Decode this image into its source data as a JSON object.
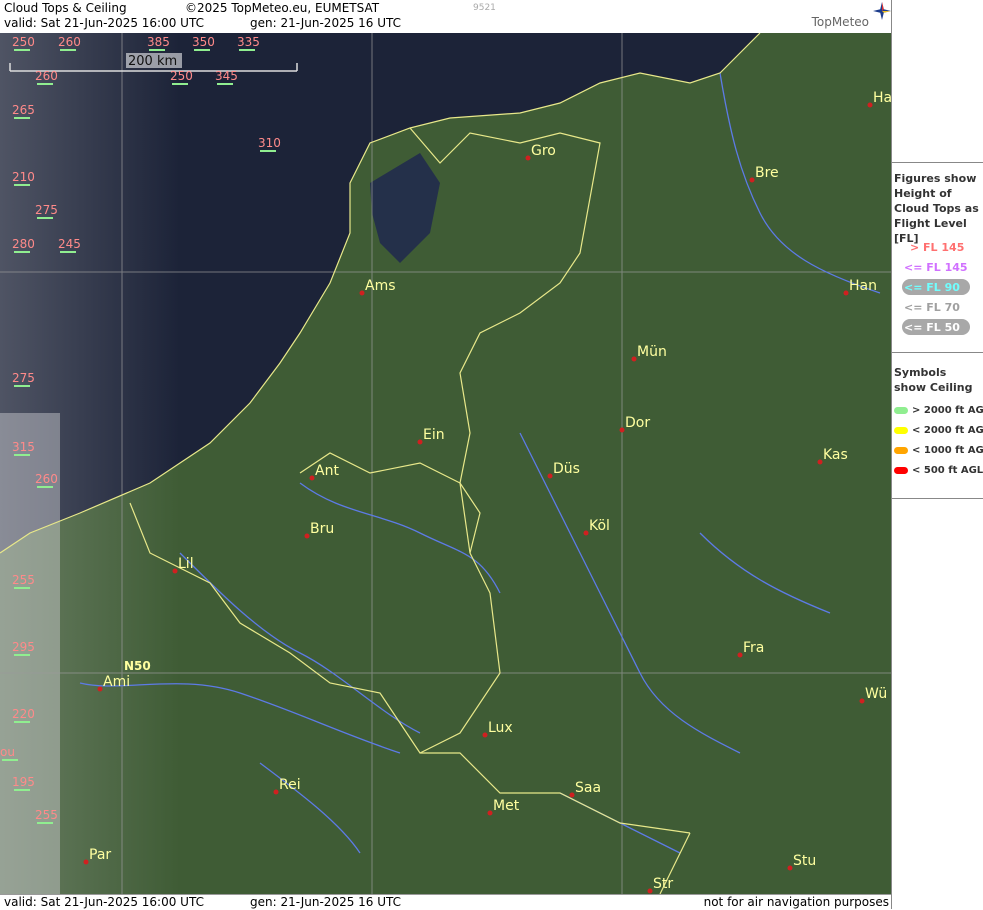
{
  "header": {
    "title": "Cloud Tops & Ceiling",
    "copyright": "©2025 TopMeteo.eu, EUMETSAT",
    "code": "9521",
    "valid": "valid:  Sat  21-Jun-2025  16:00 UTC",
    "gen": "gen:  21-Jun-2025 16 UTC",
    "logo": "TopMeteo"
  },
  "footer": {
    "valid": "valid:  Sat  21-Jun-2025  16:00 UTC",
    "gen": "gen:  21-Jun-2025 16 UTC",
    "note": "not for air navigation purposes"
  },
  "map": {
    "scale_label": "200 km",
    "lat_label": "N50",
    "cities": [
      "Gro",
      "Bre",
      "Ams",
      "Han",
      "Mün",
      "Dor",
      "Ein",
      "Ant",
      "Düs",
      "Kas",
      "Bru",
      "Köl",
      "Lil",
      "Fra",
      "Ami",
      "Wü",
      "Lux",
      "Rei",
      "Saa",
      "Met",
      "Par",
      "Stu",
      "Str",
      "Ha"
    ],
    "flight_levels": [
      "250",
      "260",
      "385",
      "350",
      "335",
      "260",
      "250",
      "345",
      "265",
      "310",
      "210",
      "275",
      "280",
      "245",
      "275",
      "315",
      "260",
      "255",
      "295",
      "220",
      "195",
      "255",
      "ou"
    ],
    "colors": {
      "water": "#1a2238",
      "land": "#3e5a34",
      "border": "#e8e88a",
      "river": "#5d7be6",
      "grid": "#9a9a9a",
      "city_dot": "#d02020"
    }
  },
  "legend": {
    "title": "Figures show Height of Cloud Tops as Flight Level  [FL]",
    "levels": [
      {
        "label": "> FL 145",
        "color": "#ff7070"
      },
      {
        "label": "<= FL 145",
        "color": "#d070ff"
      },
      {
        "label": "<= FL 90",
        "color": "#70ffff"
      },
      {
        "label": "<= FL 70",
        "color": "#a0a0a0"
      },
      {
        "label": "<= FL 50",
        "color": "#ffffff"
      }
    ],
    "symbols_title": "Symbols show Ceiling",
    "symbols": [
      {
        "label": "> 2000 ft AGL",
        "color": "#90ee90"
      },
      {
        "label": "< 2000 ft AGL",
        "color": "#ffff00"
      },
      {
        "label": "< 1000 ft AGL",
        "color": "#ffa500"
      },
      {
        "label": "< 500 ft AGL",
        "color": "#ff0000"
      }
    ]
  }
}
